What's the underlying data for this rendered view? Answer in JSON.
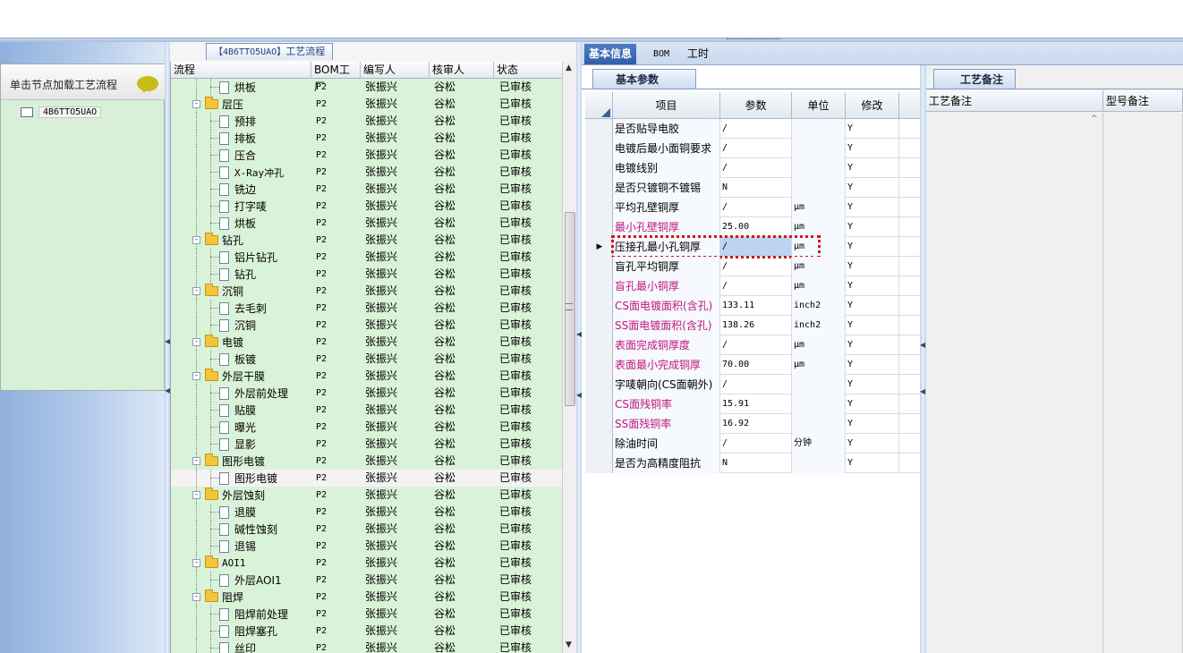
{
  "left_panel": {
    "hint": "单击节点加载工艺流程",
    "node": "4B6TTO5UAO"
  },
  "tree": {
    "tab_title_code": "【4B6TTO5UAO】",
    "tab_title_text": "工艺流程",
    "headers": [
      "流程",
      "BOM工厂",
      "编写人",
      "核审人",
      "状态"
    ],
    "rows": [
      {
        "level": 2,
        "kind": "doc",
        "name": "烘板",
        "bom": "P2",
        "writer": "张振兴",
        "reviewer": "谷松",
        "status": "已审核"
      },
      {
        "level": 1,
        "kind": "folder",
        "name": "层压",
        "bom": "P2",
        "writer": "张振兴",
        "reviewer": "谷松",
        "status": "已审核"
      },
      {
        "level": 2,
        "kind": "doc",
        "name": "预排",
        "bom": "P2",
        "writer": "张振兴",
        "reviewer": "谷松",
        "status": "已审核"
      },
      {
        "level": 2,
        "kind": "doc",
        "name": "排板",
        "bom": "P2",
        "writer": "张振兴",
        "reviewer": "谷松",
        "status": "已审核"
      },
      {
        "level": 2,
        "kind": "doc",
        "name": "压合",
        "bom": "P2",
        "writer": "张振兴",
        "reviewer": "谷松",
        "status": "已审核"
      },
      {
        "level": 2,
        "kind": "doc",
        "name": "X-Ray冲孔",
        "bom": "P2",
        "writer": "张振兴",
        "reviewer": "谷松",
        "status": "已审核"
      },
      {
        "level": 2,
        "kind": "doc",
        "name": "铣边",
        "bom": "P2",
        "writer": "张振兴",
        "reviewer": "谷松",
        "status": "已审核"
      },
      {
        "level": 2,
        "kind": "doc",
        "name": "打字唛",
        "bom": "P2",
        "writer": "张振兴",
        "reviewer": "谷松",
        "status": "已审核"
      },
      {
        "level": 2,
        "kind": "doc",
        "name": "烘板",
        "bom": "P2",
        "writer": "张振兴",
        "reviewer": "谷松",
        "status": "已审核"
      },
      {
        "level": 1,
        "kind": "folder",
        "name": "钻孔",
        "bom": "P2",
        "writer": "张振兴",
        "reviewer": "谷松",
        "status": "已审核"
      },
      {
        "level": 2,
        "kind": "doc",
        "name": "铝片钻孔",
        "bom": "P2",
        "writer": "张振兴",
        "reviewer": "谷松",
        "status": "已审核"
      },
      {
        "level": 2,
        "kind": "doc",
        "name": "钻孔",
        "bom": "P2",
        "writer": "张振兴",
        "reviewer": "谷松",
        "status": "已审核"
      },
      {
        "level": 1,
        "kind": "folder",
        "name": "沉铜",
        "bom": "P2",
        "writer": "张振兴",
        "reviewer": "谷松",
        "status": "已审核"
      },
      {
        "level": 2,
        "kind": "doc",
        "name": "去毛刺",
        "bom": "P2",
        "writer": "张振兴",
        "reviewer": "谷松",
        "status": "已审核"
      },
      {
        "level": 2,
        "kind": "doc",
        "name": "沉铜",
        "bom": "P2",
        "writer": "张振兴",
        "reviewer": "谷松",
        "status": "已审核"
      },
      {
        "level": 1,
        "kind": "folder",
        "name": "电镀",
        "bom": "P2",
        "writer": "张振兴",
        "reviewer": "谷松",
        "status": "已审核"
      },
      {
        "level": 2,
        "kind": "doc",
        "name": "板镀",
        "bom": "P2",
        "writer": "张振兴",
        "reviewer": "谷松",
        "status": "已审核"
      },
      {
        "level": 1,
        "kind": "folder",
        "name": "外层干膜",
        "bom": "P2",
        "writer": "张振兴",
        "reviewer": "谷松",
        "status": "已审核"
      },
      {
        "level": 2,
        "kind": "doc",
        "name": "外层前处理",
        "bom": "P2",
        "writer": "张振兴",
        "reviewer": "谷松",
        "status": "已审核"
      },
      {
        "level": 2,
        "kind": "doc",
        "name": "贴膜",
        "bom": "P2",
        "writer": "张振兴",
        "reviewer": "谷松",
        "status": "已审核"
      },
      {
        "level": 2,
        "kind": "doc",
        "name": "曝光",
        "bom": "P2",
        "writer": "张振兴",
        "reviewer": "谷松",
        "status": "已审核"
      },
      {
        "level": 2,
        "kind": "doc",
        "name": "显影",
        "bom": "P2",
        "writer": "张振兴",
        "reviewer": "谷松",
        "status": "已审核"
      },
      {
        "level": 1,
        "kind": "folder",
        "name": "图形电镀",
        "bom": "P2",
        "writer": "张振兴",
        "reviewer": "谷松",
        "status": "已审核"
      },
      {
        "level": 2,
        "kind": "doc",
        "name": "图形电镀",
        "bom": "P2",
        "writer": "张振兴",
        "reviewer": "谷松",
        "status": "已审核",
        "selected": true
      },
      {
        "level": 1,
        "kind": "folder",
        "name": "外层蚀刻",
        "bom": "P2",
        "writer": "张振兴",
        "reviewer": "谷松",
        "status": "已审核"
      },
      {
        "level": 2,
        "kind": "doc",
        "name": "退膜",
        "bom": "P2",
        "writer": "张振兴",
        "reviewer": "谷松",
        "status": "已审核"
      },
      {
        "level": 2,
        "kind": "doc",
        "name": "碱性蚀刻",
        "bom": "P2",
        "writer": "张振兴",
        "reviewer": "谷松",
        "status": "已审核"
      },
      {
        "level": 2,
        "kind": "doc",
        "name": "退锡",
        "bom": "P2",
        "writer": "张振兴",
        "reviewer": "谷松",
        "status": "已审核"
      },
      {
        "level": 1,
        "kind": "folder",
        "name": "AOI1",
        "bom": "P2",
        "writer": "张振兴",
        "reviewer": "谷松",
        "status": "已审核"
      },
      {
        "level": 2,
        "kind": "doc",
        "name": "外层AOI1",
        "bom": "P2",
        "writer": "张振兴",
        "reviewer": "谷松",
        "status": "已审核"
      },
      {
        "level": 1,
        "kind": "folder",
        "name": "阻焊",
        "bom": "P2",
        "writer": "张振兴",
        "reviewer": "谷松",
        "status": "已审核"
      },
      {
        "level": 2,
        "kind": "doc",
        "name": "阻焊前处理",
        "bom": "P2",
        "writer": "张振兴",
        "reviewer": "谷松",
        "status": "已审核"
      },
      {
        "level": 2,
        "kind": "doc",
        "name": "阻焊塞孔",
        "bom": "P2",
        "writer": "张振兴",
        "reviewer": "谷松",
        "status": "已审核"
      },
      {
        "level": 2,
        "kind": "doc",
        "name": "丝印",
        "bom": "P2",
        "writer": "张振兴",
        "reviewer": "谷松",
        "status": "已审核"
      }
    ]
  },
  "tabs": [
    "基本信息",
    "BOM",
    "工时"
  ],
  "params": {
    "subtab": "基本参数",
    "headers": [
      "项目",
      "参数",
      "单位",
      "修改"
    ],
    "rows": [
      {
        "item": "是否贴导电胶",
        "value": "/",
        "unit": "",
        "mod": "Y",
        "pink": false
      },
      {
        "item": "电镀后最小面铜要求",
        "value": "/",
        "unit": "",
        "mod": "Y",
        "pink": false
      },
      {
        "item": "电镀线别",
        "value": "/",
        "unit": "",
        "mod": "Y",
        "pink": false
      },
      {
        "item": "是否只镀铜不镀锡",
        "value": "N",
        "unit": "",
        "mod": "Y",
        "pink": false
      },
      {
        "item": "平均孔壁铜厚",
        "value": "/",
        "unit": "μm",
        "mod": "Y",
        "pink": false
      },
      {
        "item": "最小孔壁铜厚",
        "value": "25.00",
        "unit": "μm",
        "mod": "Y",
        "pink": true
      },
      {
        "item": "压接孔最小孔铜厚",
        "value": "/",
        "unit": "μm",
        "mod": "Y",
        "pink": false,
        "current": true
      },
      {
        "item": "盲孔平均铜厚",
        "value": "/",
        "unit": "μm",
        "mod": "Y",
        "pink": false
      },
      {
        "item": "盲孔最小铜厚",
        "value": "/",
        "unit": "μm",
        "mod": "Y",
        "pink": true
      },
      {
        "item": "CS面电镀面积(含孔)",
        "value": "133.11",
        "unit": "inch2",
        "mod": "Y",
        "pink": true
      },
      {
        "item": "SS面电镀面积(含孔)",
        "value": "138.26",
        "unit": "inch2",
        "mod": "Y",
        "pink": true
      },
      {
        "item": "表面完成铜厚度",
        "value": "/",
        "unit": "μm",
        "mod": "Y",
        "pink": true
      },
      {
        "item": "表面最小完成铜厚",
        "value": "70.00",
        "unit": "μm",
        "mod": "Y",
        "pink": true
      },
      {
        "item": "字唛朝向(CS面朝外)",
        "value": "/",
        "unit": "",
        "mod": "Y",
        "pink": false
      },
      {
        "item": "CS面残铜率",
        "value": "15.91",
        "unit": "",
        "mod": "Y",
        "pink": true
      },
      {
        "item": "SS面残铜率",
        "value": "16.92",
        "unit": "",
        "mod": "Y",
        "pink": true
      },
      {
        "item": "除油时间",
        "value": "/",
        "unit": "分钟",
        "mod": "Y",
        "pink": false
      },
      {
        "item": "是否为高精度阻抗",
        "value": "N",
        "unit": "",
        "mod": "Y",
        "pink": false
      }
    ]
  },
  "notes": {
    "tab": "工艺备注",
    "columns": [
      "工艺备注",
      "型号备注"
    ]
  },
  "colors": {
    "tree_bg": "#d9f3d9",
    "pink_text": "#c0187a",
    "highlight": "#d31616",
    "tab_active": "#2f5ea9"
  }
}
